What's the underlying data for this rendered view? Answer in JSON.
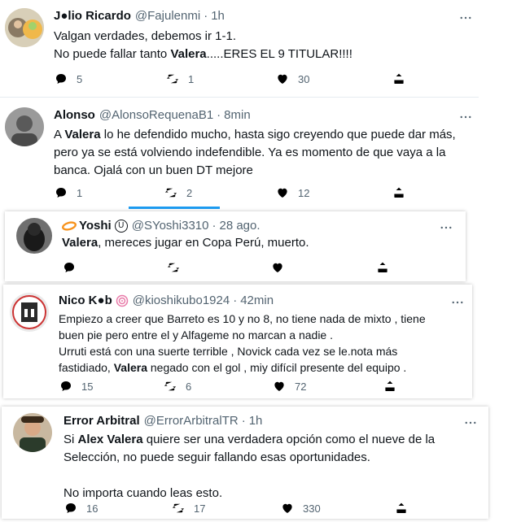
{
  "tweets": [
    {
      "name": "J●lio Ricardo",
      "handle": "@Fajulenmi",
      "time": "1h",
      "line1": "Valgan verdades, debemos ir 1-1.",
      "line2_pre": "No puede fallar tanto ",
      "line2_bold": "Valera",
      "line2_post": ".....ERES EL 9 TITULAR!!!!",
      "replies": "5",
      "retweets": "1",
      "likes": "30"
    },
    {
      "name": "Alonso",
      "handle": "@AlonsoRequenaB1",
      "time": "8min",
      "line1_pre": "A ",
      "line1_bold": "Valera",
      "line1_post": " lo he defendido mucho, hasta sigo creyendo que puede dar más,",
      "line2": "pero ya se está volviendo indefendible. Ya es momento de que vaya a la",
      "line3": "banca. Ojalá con un buen DT mejore",
      "replies": "1",
      "retweets": "2",
      "likes": "12"
    },
    {
      "name": "Yoshi",
      "handle": "@SYoshi3310",
      "time": "28 ago.",
      "line1_bold": "Valera",
      "line1_post": ", mereces jugar en Copa Perú, muerto.",
      "replies": "",
      "retweets": "",
      "likes": ""
    },
    {
      "name": "Nico K●b",
      "handle": "@kioshikubo1924",
      "time": "42min",
      "line1": "Empiezo a creer que Barreto es 10 y no 8, no tiene nada de mixto , tiene",
      "line2": "buen pie pero entre el y Alfageme no marcan a nadie .",
      "line3": "Urruti está con una suerte terrible , Novick cada vez se le.nota más",
      "line4_pre": "fastidiado, ",
      "line4_bold": "Valera",
      "line4_post": " negado con el gol , miy difícil presente del equipo .",
      "replies": "15",
      "retweets": "6",
      "likes": "72"
    },
    {
      "name": "Error Arbitral",
      "handle": "@ErrorArbitralTR",
      "time": "1h",
      "line1_pre": "Si ",
      "line1_bold": "Alex Valera",
      "line1_post": " quiere ser una verdadera opción como el nueve de la",
      "line2": "Selección, no puede seguir fallando esas oportunidades.",
      "line3": "No importa cuando leas esto.",
      "replies": "16",
      "retweets": "17",
      "likes": "330"
    }
  ],
  "icons": {
    "reply": "reply-icon",
    "retweet": "retweet-icon",
    "like": "heart-icon",
    "share": "share-icon",
    "more": "more-icon"
  },
  "colors": {
    "text": "#0f1419",
    "secondary": "#536471",
    "accent": "#1d9bf0",
    "yoshi_logo": "#f7931e"
  }
}
